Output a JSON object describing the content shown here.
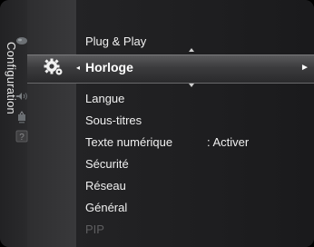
{
  "sidebar": {
    "category_label": "Configuration",
    "icons": [
      {
        "name": "picture-icon"
      },
      {
        "name": "setup-gear-icon"
      },
      {
        "name": "sound-icon"
      },
      {
        "name": "channel-icon"
      },
      {
        "name": "support-icon"
      }
    ]
  },
  "menu": {
    "items": [
      {
        "label": "Plug & Play"
      },
      {
        "label": "Horloge",
        "selected": true
      },
      {
        "label": "Langue"
      },
      {
        "label": "Sous-titres"
      },
      {
        "label": "Texte numérique",
        "value": ": Activer"
      },
      {
        "label": "Sécurité"
      },
      {
        "label": "Réseau"
      },
      {
        "label": "Général"
      },
      {
        "label": "PIP",
        "disabled": true
      }
    ],
    "selected_arrow_left": "◂",
    "selected_arrow_right": "►"
  },
  "colors": {
    "background": "#1b1b1d",
    "highlight": "#4a4a4c",
    "text": "#f0f0f0",
    "disabled_text": "#5e5e60"
  }
}
